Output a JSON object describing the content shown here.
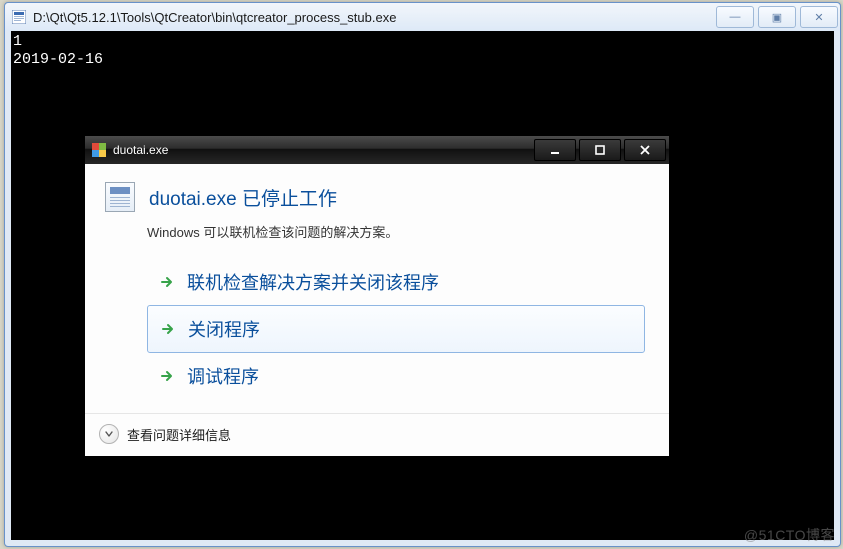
{
  "outer": {
    "title": "D:\\Qt\\Qt5.12.1\\Tools\\QtCreator\\bin\\qtcreator_process_stub.exe",
    "buttons": {
      "minimize": "—",
      "maximize": "▣",
      "close": "✕"
    }
  },
  "console": {
    "line1": "1",
    "line2": "2019-02-16"
  },
  "dialog": {
    "title": "duotai.exe",
    "heading": "duotai.exe 已停止工作",
    "subtext": "Windows 可以联机检查该问题的解决方案。",
    "options": [
      {
        "label": "联机检查解决方案并关闭该程序",
        "selected": false
      },
      {
        "label": "关闭程序",
        "selected": true
      },
      {
        "label": "调试程序",
        "selected": false
      }
    ],
    "details_label": "查看问题详细信息"
  },
  "watermark": "@51CTO博客"
}
